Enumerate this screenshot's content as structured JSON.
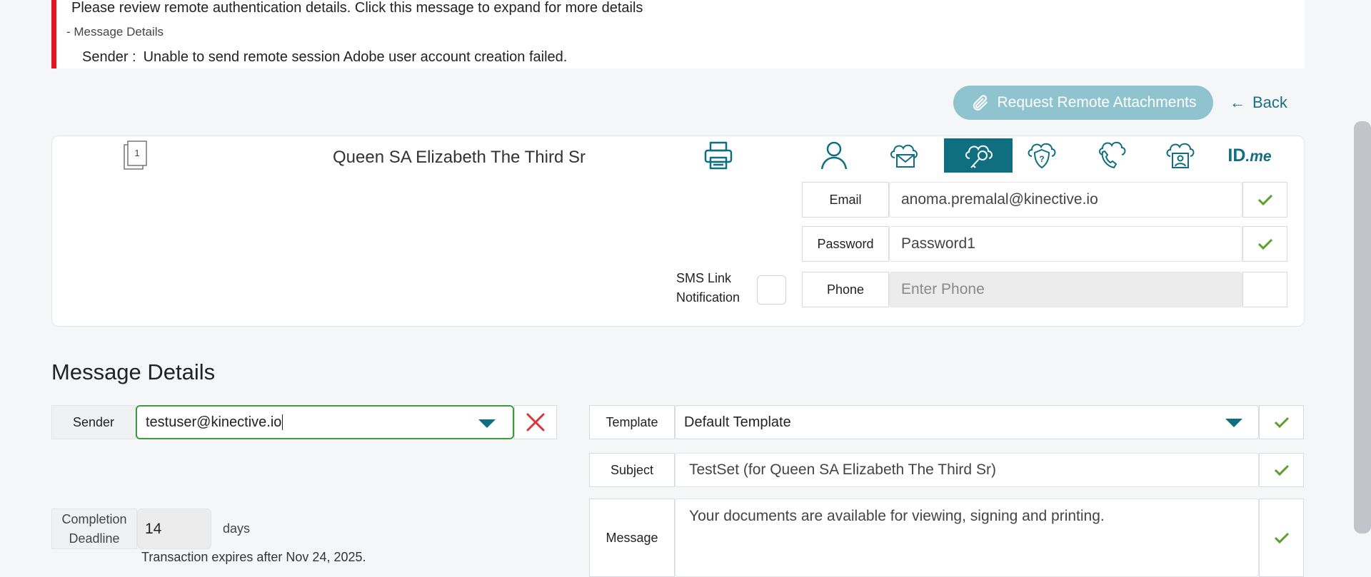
{
  "alert": {
    "title": "Please review remote authentication details. Click this message to expand for more details",
    "toggle": "- Message Details",
    "detail_label": "Sender :",
    "detail_text": "Unable to send remote session Adobe user account creation failed."
  },
  "actions": {
    "attach_label": "Request Remote Attachments",
    "back_label": "Back",
    "back_arrow": "←"
  },
  "signer": {
    "doc_number": "1",
    "name": "Queen SA Elizabeth The Third Sr",
    "auth_tabs": [
      "person-icon",
      "email-cloud-icon",
      "key-cloud-icon",
      "question-shield-icon",
      "phone-cloud-icon",
      "id-cloud-icon",
      "idme-logo"
    ],
    "active_tab": "key-cloud-icon",
    "idme_text": "ID",
    "idme_suffix": ".me",
    "email_label": "Email",
    "email_value": "anoma.premalal@kinective.io",
    "password_label": "Password",
    "password_value": "Password1",
    "sms_label_line1": "SMS Link",
    "sms_label_line2": "Notification",
    "phone_label": "Phone",
    "phone_placeholder": "Enter Phone"
  },
  "message": {
    "section_title": "Message Details",
    "sender_label": "Sender",
    "sender_value": "testuser@kinective.io",
    "template_label": "Template",
    "template_value": "Default Template",
    "subject_label": "Subject",
    "subject_value": "TestSet (for Queen SA Elizabeth The Third Sr)",
    "message_label": "Message",
    "message_value": "Your documents are available for viewing, signing and printing.",
    "deadline_label_line1": "Completion",
    "deadline_label_line2": "Deadline",
    "deadline_value": "14",
    "deadline_unit": "days",
    "expires_text": "Transaction expires after Nov 24, 2025."
  },
  "colors": {
    "accent": "#0f6f80",
    "alert_red": "#e0171f",
    "check_green": "#5aa02c",
    "error_red": "#d9343b"
  }
}
